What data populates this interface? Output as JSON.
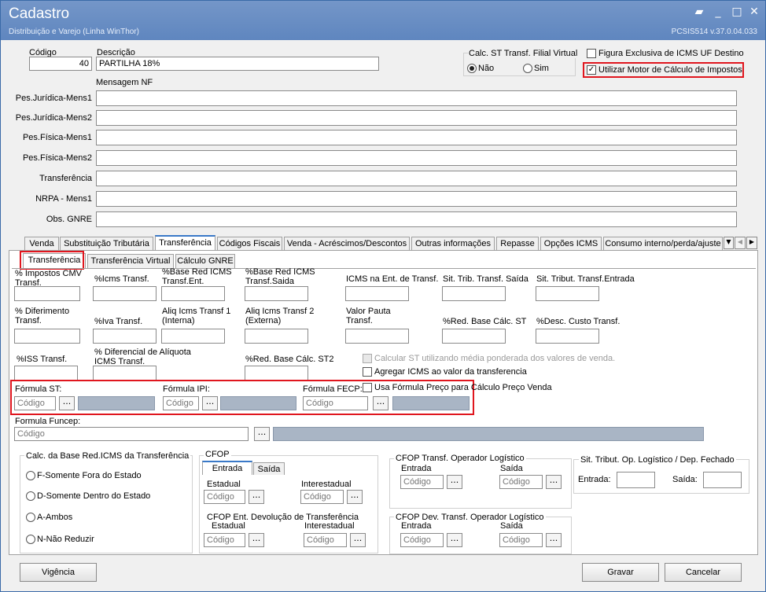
{
  "window": {
    "title": "Cadastro",
    "subtitle": "Distribuição e Varejo (Linha WinThor)",
    "version": "PCSIS514  v.37.0.04.033",
    "controls": [
      "▰",
      "_",
      "□",
      "✕"
    ]
  },
  "header": {
    "codigo_label": "Código",
    "codigo_value": "40",
    "descricao_label": "Descrição",
    "descricao_value": "PARTILHA 18%",
    "calc_st_label": "Calc. ST Transf. Filial Virtual",
    "radio_nao": "Não",
    "radio_sim": "Sim",
    "figura_exclusiva": "Figura Exclusiva de ICMS UF Destino",
    "utilizar_motor": "Utilizar Motor de Cálculo de Impostos",
    "mensagem_nf_label": "Mensagem NF"
  },
  "messages": [
    {
      "label": "Pes.Jurídica-Mens1",
      "value": ""
    },
    {
      "label": "Pes.Jurídica-Mens2",
      "value": ""
    },
    {
      "label": "Pes.Física-Mens1",
      "value": ""
    },
    {
      "label": "Pes.Física-Mens2",
      "value": ""
    },
    {
      "label": "Transferência",
      "value": ""
    },
    {
      "label": "NRPA - Mens1",
      "value": ""
    },
    {
      "label": "Obs. GNRE",
      "value": ""
    }
  ],
  "main_tabs": [
    "Venda",
    "Substituição Tributária",
    "Transferência",
    "Códigos Fiscais",
    "Venda - Acréscimos/Descontos",
    "Outras informações",
    "Repasse",
    "Opções ICMS",
    "Consumo interno/perda/ajuste"
  ],
  "sub_tabs": [
    "Transferência",
    "Transferência Virtual",
    "Cálculo GNRE"
  ],
  "fields": {
    "impostos_cmv": "% Impostos CMV Transf.",
    "icms_transf": "%Icms Transf.",
    "base_red_ent": "%Base Red ICMS Transf.Ent.",
    "base_red_saida": "%Base Red ICMS Transf.Saida",
    "icms_ent_transf": "ICMS na Ent. de Transf.",
    "sit_trib_saida": "Sit. Trib. Transf. Saída",
    "sit_trib_entrada": "Sit. Tribut. Transf.Entrada",
    "diferimento": "% Diferimento Transf.",
    "iva_transf": "%Iva Transf.",
    "aliq_interna": "Aliq Icms Transf 1 (Interna)",
    "aliq_externa": "Aliq Icms Transf 2 (Externa)",
    "valor_pauta": "Valor Pauta Transf.",
    "red_base_st": "%Red. Base Cálc. ST",
    "desc_custo": "%Desc. Custo Transf.",
    "iss_transf": "%ISS  Transf.",
    "dif_aliquota": "% Diferencial de Alíquota ICMS Transf.",
    "red_base_st2": "%Red. Base Cálc. ST2",
    "calcular_st_media": "Calcular ST utilizando média ponderada dos valores de venda.",
    "agregar_icms": "Agregar ICMS ao valor da transferencia",
    "usa_formula": "Usa Fórmula Preço para Cálculo Preço Venda"
  },
  "formulas": {
    "st_label": "Fórmula ST:",
    "ipi_label": "Fórmula IPI:",
    "fecp_label": "Fórmula FECP:",
    "funcep_label": "Formula Funcep:",
    "placeholder": "Código",
    "ellipsis": "..."
  },
  "calc_base": {
    "title": "Calc. da Base Red.ICMS da Transferência",
    "options": [
      "F-Somente Fora do Estado",
      "D-Somente Dentro do Estado",
      "A-Ambos",
      "N-Não Reduzir"
    ]
  },
  "cfop": {
    "title": "CFOP",
    "tab_entrada": "Entrada",
    "tab_saida": "Saída",
    "estadual": "Estadual",
    "interestadual": "Interestadual",
    "dev_title": "CFOP Ent. Devolução de Transferência",
    "oper_title": "CFOP Transf. Operador Logístico",
    "oper_dev_title": "CFOP Dev. Transf. Operador Logístico",
    "entrada": "Entrada",
    "saida": "Saída"
  },
  "sit_tribut_op": {
    "title": "Sit. Tribut. Op. Logístico / Dep. Fechado",
    "entrada": "Entrada:",
    "saida": "Saída:"
  },
  "footer": {
    "vigencia": "Vigência",
    "gravar": "Gravar",
    "cancelar": "Cancelar"
  }
}
